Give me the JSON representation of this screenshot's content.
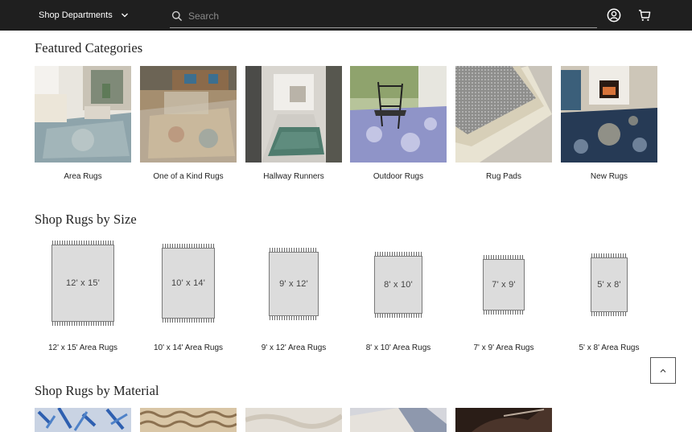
{
  "header": {
    "departments_label": "Shop Departments",
    "search_placeholder": "Search"
  },
  "featured": {
    "title": "Featured Categories",
    "items": [
      {
        "label": "Area Rugs"
      },
      {
        "label": "One of a Kind Rugs"
      },
      {
        "label": "Hallway Runners"
      },
      {
        "label": "Outdoor Rugs"
      },
      {
        "label": "Rug Pads"
      },
      {
        "label": "New Rugs"
      }
    ]
  },
  "sizes": {
    "title": "Shop Rugs by Size",
    "items": [
      {
        "size": "12' x 15'",
        "label": "12' x 15' Area Rugs"
      },
      {
        "size": "10' x 14'",
        "label": "10' x 14' Area Rugs"
      },
      {
        "size": "9' x 12'",
        "label": "9' x 12' Area Rugs"
      },
      {
        "size": "8' x 10'",
        "label": "8' x 10' Area Rugs"
      },
      {
        "size": "7' x 9'",
        "label": "7' x 9' Area Rugs"
      },
      {
        "size": "5' x 8'",
        "label": "5' x 8' Area Rugs"
      }
    ]
  },
  "material": {
    "title": "Shop Rugs by Material"
  },
  "icons": {
    "departments_chevron": "chevron-down-icon",
    "search": "search-icon",
    "account": "account-icon",
    "cart": "cart-icon",
    "back_to_top": "chevron-up-icon"
  },
  "colors": {
    "header_bg": "#1f1f1f",
    "text": "#222222"
  }
}
